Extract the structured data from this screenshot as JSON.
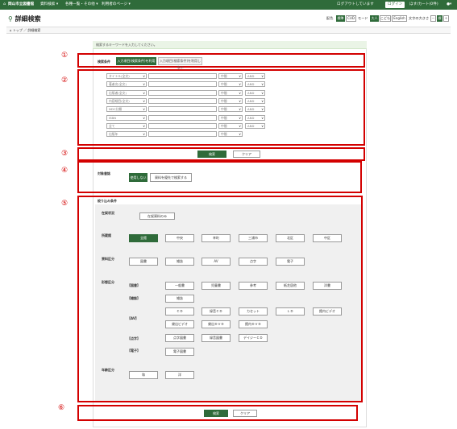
{
  "topbar": {
    "site": "岡山市立図書館",
    "menu1": "資料検索 ▾",
    "menu2": "各種一覧・その他 ▾",
    "menu3": "利用者のページ ▾",
    "logout": "ログアウトしています",
    "login": "ログイン",
    "cart": "ほす/カート(0件)"
  },
  "page": {
    "title": "詳細検索",
    "breadcrumb_home": "トップ",
    "breadcrumb_current": "詳細検索"
  },
  "display": {
    "label_color": "配色",
    "color_std": "標準",
    "color_cud": "CUD",
    "label_mode": "モード",
    "mode_big": "大人",
    "mode_kids": "こども",
    "lang": "English",
    "label_size": "文字の大きさ",
    "size_minus": "－",
    "size_std": "標",
    "size_plus": "＋"
  },
  "hint": "検索するキーワードを入力してください。",
  "numbers": [
    "①",
    "②",
    "③",
    "④",
    "⑤",
    "⑥"
  ],
  "conditions": {
    "label": "検索条件",
    "tab_on": "入力項目(検索条件)を利用する",
    "tab_off": "入力項目(検索条件)を利用しない"
  },
  "rows": [
    {
      "field": "タイトル(全文)",
      "match": "中間",
      "op": "AND"
    },
    {
      "field": "著者名(全文)",
      "match": "中間",
      "op": "AND"
    },
    {
      "field": "出版者(全文)",
      "match": "中間",
      "op": "AND"
    },
    {
      "field": "内容細目(全文)",
      "match": "中間",
      "op": "AND"
    },
    {
      "field": "NDC分類",
      "match": "中間",
      "op": "AND"
    },
    {
      "field": "ISBN",
      "match": "中間",
      "op": "AND"
    },
    {
      "field": "全て",
      "match": "中間",
      "op": "AND"
    },
    {
      "field": "出版年",
      "match": "中間",
      "op": ""
    }
  ],
  "actions": {
    "search": "検索",
    "clear": "クリア"
  },
  "target": {
    "note": "対象書誌",
    "label": "対象書誌",
    "opt1": "使用しない",
    "opt2": "資料を優先で検索する"
  },
  "filter": {
    "section": "絞り込み条件",
    "status_label": "在架状況",
    "status_opt": "在架資料のみ",
    "library_label": "所蔵館",
    "libraries": [
      "全館",
      "中央",
      "幸町",
      "三浦市",
      "北区",
      "中区"
    ],
    "type_label": "資料区分",
    "types": [
      "図書",
      "雑誌",
      "AV",
      "点字",
      "電子"
    ],
    "form_label": "形態区分",
    "book_label": "【図書】",
    "books": [
      "一般書",
      "児童書",
      "参考",
      "紙芝居他",
      "洋書"
    ],
    "magazine_label": "【雑誌】",
    "magazines": [
      "雑誌"
    ],
    "av_label": "【AV】",
    "avs_row1": [
      "ＣＤ",
      "録音ＣＤ",
      "カセット",
      "ＬＤ",
      "館内ビデオ"
    ],
    "avs_row2": [
      "貸出ビデオ",
      "貸出ＤＶＤ",
      "館内ＤＶＤ"
    ],
    "braille_label": "【点字】",
    "brailles": [
      "点字図書",
      "録音図書",
      "デイジーＣＤ"
    ],
    "ebook_label": "【電子】",
    "ebooks": [
      "電子図書"
    ],
    "age_label": "年齢区分",
    "ages": [
      "和",
      "洋"
    ]
  }
}
